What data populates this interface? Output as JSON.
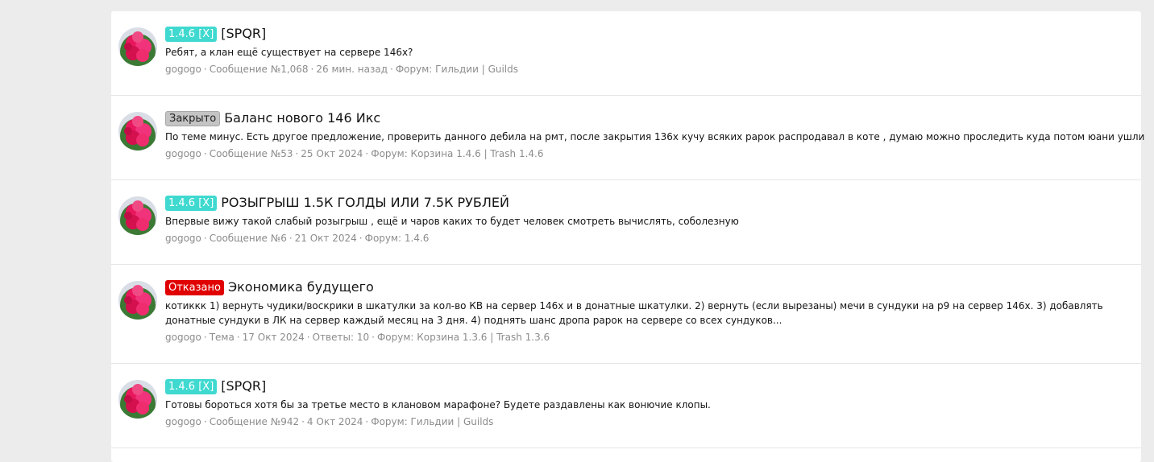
{
  "results": [
    {
      "badge": "1.4.6 [X]",
      "badge_type": "version",
      "title": "[SPQR]",
      "snippet": "Ребят, а клан ещё существует на сервере 146х?",
      "meta": [
        "gogogo",
        "Сообщение №1,068",
        "26 мин. назад",
        "Форум: Гильдии | Guilds"
      ]
    },
    {
      "badge": "Закрыто",
      "badge_type": "closed",
      "title": "Баланс нового 146 Икс",
      "snippet": "По теме минус. Есть другое предложение, проверить данного дебила на рмт, после закрытия 136х кучу всяких рарок распродавал в коте , думаю можно проследить куда потом юани ушли",
      "meta": [
        "gogogo",
        "Сообщение №53",
        "25 Окт 2024",
        "Форум: Корзина 1.4.6 | Trash 1.4.6"
      ]
    },
    {
      "badge": "1.4.6 [X]",
      "badge_type": "version",
      "title": "РОЗЫГРЫШ 1.5К ГОЛДЫ ИЛИ 7.5К РУБЛЕЙ",
      "snippet": "Впервые вижу такой слабый розыгрыш , ещё и чаров каких то будет человек смотреть вычислять, соболезную",
      "meta": [
        "gogogo",
        "Сообщение №6",
        "21 Окт 2024",
        "Форум: 1.4.6"
      ]
    },
    {
      "badge": "Отказано",
      "badge_type": "denied",
      "title": "Экономика будущего",
      "snippet": "котиккк 1) вернуть чудики/воскрики в шкатулки за кол-во КВ на сервер 146х и в донатные шкатулки. 2) вернуть (если вырезаны) мечи в сундуки на р9 на сервер 146х. 3) добавлять донатные сундуки в ЛК на сервер каждый месяц на 3 дня. 4) поднять шанс дропа рарок на сервере со всех сундуков...",
      "meta": [
        "gogogo",
        "Тема",
        "17 Окт 2024",
        "Ответы: 10",
        "Форум: Корзина 1.3.6 | Trash 1.3.6"
      ]
    },
    {
      "badge": "1.4.6 [X]",
      "badge_type": "version",
      "title": "[SPQR]",
      "snippet": "Готовы бороться хотя бы за третье место в клановом марафоне? Будете раздавлены как вонючие клопы.",
      "meta": [
        "gogogo",
        "Сообщение №942",
        "4 Окт 2024",
        "Форум: Гильдии | Guilds"
      ]
    }
  ],
  "meta_separator": "·",
  "colors": {
    "version_badge": "#3fd9d0",
    "closed_badge": "#c4c4c4",
    "denied_badge": "#e00000",
    "meta_text": "#8c8c8c"
  },
  "avatar_icon": "roses-bouquet-avatar"
}
